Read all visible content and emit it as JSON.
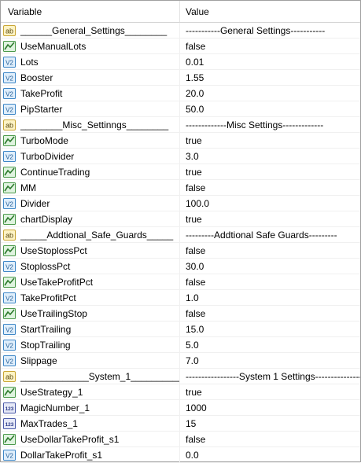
{
  "headers": {
    "variable": "Variable",
    "value": "Value"
  },
  "rows": [
    {
      "icon": "string-icon",
      "name": "______General_Settings________",
      "value": "-----------General Settings-----------"
    },
    {
      "icon": "bool-icon",
      "name": "UseManualLots",
      "value": "false"
    },
    {
      "icon": "double-icon",
      "name": "Lots",
      "value": "0.01"
    },
    {
      "icon": "double-icon",
      "name": "Booster",
      "value": "1.55"
    },
    {
      "icon": "double-icon",
      "name": "TakeProfit",
      "value": "20.0"
    },
    {
      "icon": "double-icon",
      "name": "PipStarter",
      "value": "50.0"
    },
    {
      "icon": "string-icon",
      "name": "________Misc_Settinngs________",
      "value": "-------------Misc Settings-------------"
    },
    {
      "icon": "bool-icon",
      "name": "TurboMode",
      "value": "true"
    },
    {
      "icon": "double-icon",
      "name": "TurboDivider",
      "value": "3.0"
    },
    {
      "icon": "bool-icon",
      "name": "ContinueTrading",
      "value": "true"
    },
    {
      "icon": "bool-icon",
      "name": "MM",
      "value": "false"
    },
    {
      "icon": "double-icon",
      "name": "Divider",
      "value": "100.0"
    },
    {
      "icon": "bool-icon",
      "name": "chartDisplay",
      "value": "true"
    },
    {
      "icon": "string-icon",
      "name": "_____Addtional_Safe_Guards_____",
      "value": "---------Addtional Safe Guards---------"
    },
    {
      "icon": "bool-icon",
      "name": "UseStoplossPct",
      "value": "false"
    },
    {
      "icon": "double-icon",
      "name": "StoplossPct",
      "value": "30.0"
    },
    {
      "icon": "bool-icon",
      "name": "UseTakeProfitPct",
      "value": "false"
    },
    {
      "icon": "double-icon",
      "name": "TakeProfitPct",
      "value": "1.0"
    },
    {
      "icon": "bool-icon",
      "name": "UseTrailingStop",
      "value": "false"
    },
    {
      "icon": "double-icon",
      "name": "StartTrailing",
      "value": "15.0"
    },
    {
      "icon": "double-icon",
      "name": "StopTrailing",
      "value": "5.0"
    },
    {
      "icon": "double-icon",
      "name": "Slippage",
      "value": "7.0"
    },
    {
      "icon": "string-icon",
      "name": "_____________System_1____________",
      "value": "-----------------System 1 Settings------------------"
    },
    {
      "icon": "bool-icon",
      "name": "UseStrategy_1",
      "value": "true"
    },
    {
      "icon": "int-icon",
      "name": "MagicNumber_1",
      "value": "1000"
    },
    {
      "icon": "int-icon",
      "name": "MaxTrades_1",
      "value": "15"
    },
    {
      "icon": "bool-icon",
      "name": "UseDollarTakeProfit_s1",
      "value": "false"
    },
    {
      "icon": "double-icon",
      "name": "DollarTakeProfit_s1",
      "value": "0.0"
    }
  ]
}
